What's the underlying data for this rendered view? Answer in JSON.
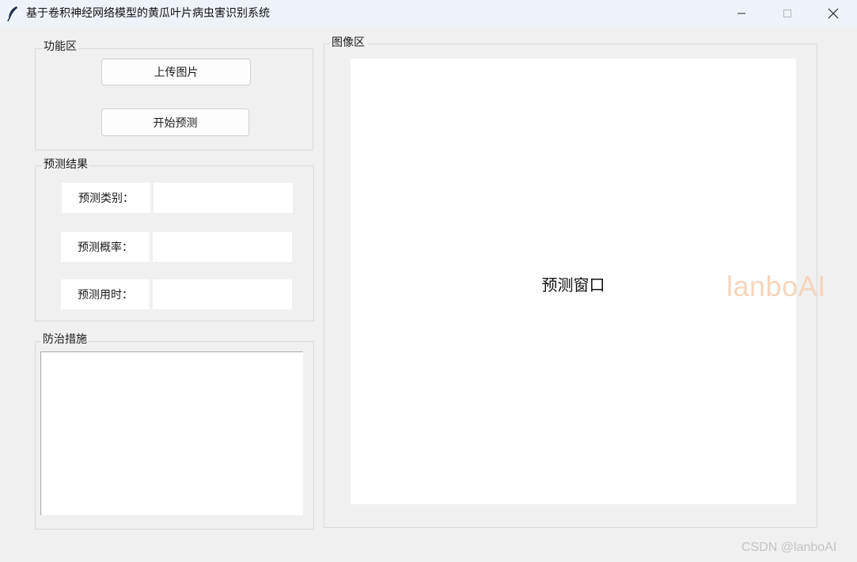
{
  "window": {
    "title": "基于卷积神经网络模型的黄瓜叶片病虫害识别系统",
    "icon": "feather-icon",
    "controls": [
      "minimize-icon",
      "maximize-icon",
      "close-icon"
    ]
  },
  "function_area": {
    "label": "功能区",
    "upload_button": "上传图片",
    "predict_button": "开始预测"
  },
  "results": {
    "label": "预测结果",
    "category_label": "预测类别：",
    "category_value": "",
    "probability_label": "预测概率：",
    "probability_value": "",
    "time_label": "预测用时：",
    "time_value": ""
  },
  "prevention": {
    "label": "防治措施",
    "text": ""
  },
  "image_area": {
    "label": "图像区",
    "canvas_text": "预测窗口"
  },
  "watermarks": {
    "main": "lanboAI",
    "corner": "CSDN @lanboAI"
  }
}
